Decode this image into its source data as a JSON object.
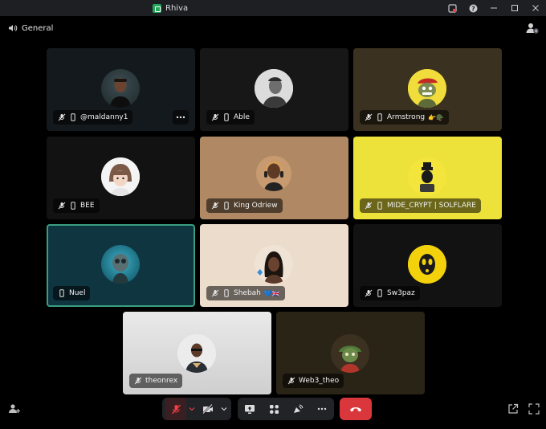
{
  "window": {
    "app_name": "Rhiva",
    "icons": [
      "inbox-icon",
      "help-icon",
      "minimize-icon",
      "maximize-icon",
      "close-icon"
    ]
  },
  "channel": {
    "name": "General",
    "icon": "speaker-icon"
  },
  "participants": [
    {
      "name": "@maldanny1",
      "muted": true,
      "mobile": true,
      "bg": "#14191d",
      "emoji": ""
    },
    {
      "name": "Able",
      "muted": true,
      "mobile": true,
      "bg": "#171717",
      "emoji": ""
    },
    {
      "name": "Armstrong",
      "muted": true,
      "mobile": true,
      "bg": "#3a3120",
      "emoji": "👉🪖"
    },
    {
      "name": "BEE",
      "muted": true,
      "mobile": true,
      "bg": "#121212",
      "emoji": ""
    },
    {
      "name": "King Odriew",
      "muted": true,
      "mobile": true,
      "bg": "#b08964",
      "emoji": ""
    },
    {
      "name": "MIDE_CRYPT | SOLFLARE",
      "muted": true,
      "mobile": true,
      "bg": "#ede23a",
      "emoji": ""
    },
    {
      "name": "Nuel",
      "muted": false,
      "mobile": true,
      "bg": "#0f3640",
      "emoji": "",
      "speaking": true
    },
    {
      "name": "Shebah",
      "muted": true,
      "mobile": true,
      "bg": "#ecdccb",
      "emoji": "💙🇬🇧"
    },
    {
      "name": "Sw3paz",
      "muted": true,
      "mobile": true,
      "bg": "#121212",
      "emoji": ""
    },
    {
      "name": "theonrex",
      "muted": true,
      "mobile": false,
      "bg": "#e6e6e6",
      "emoji": ""
    },
    {
      "name": "Web3_theo",
      "muted": true,
      "mobile": false,
      "bg": "#2a2417",
      "emoji": ""
    }
  ],
  "controls": {
    "mic": "mic-off-icon",
    "camera": "camera-off-icon",
    "share": "screen-share-icon",
    "activities": "activities-icon",
    "soundboard": "soundboard-icon",
    "more": "more-icon",
    "leave": "hang-up-icon",
    "colors": {
      "leave": "#da373c",
      "muted_mic": "#f23f43"
    }
  }
}
